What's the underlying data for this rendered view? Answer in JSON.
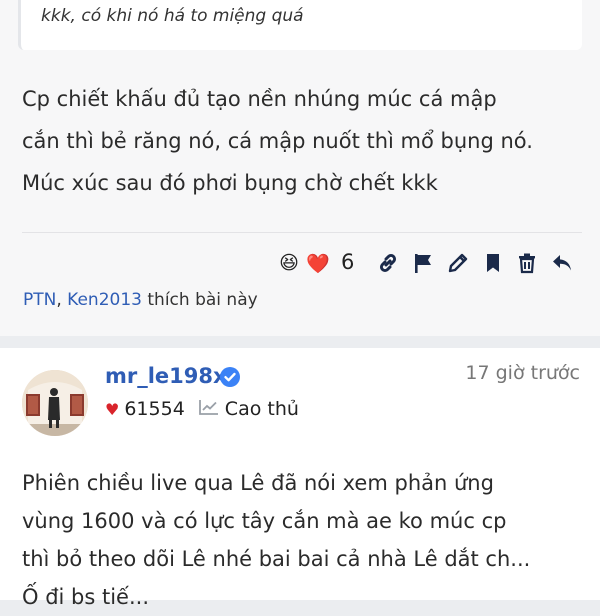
{
  "post1": {
    "quote": "kkk, có khi nó há to miệng quá",
    "body_lines": [
      "Cp chiết khấu đủ tạo nền nhúng múc cá mập",
      "cắn thì bẻ răng nó, cá mập nuốt thì mổ bụng nó.",
      "Múc xúc sau đó phơi bụng chờ chết kkk"
    ],
    "reactions": {
      "emoji": "😆",
      "heart": "❤️",
      "count": "6"
    },
    "icons": [
      "link-icon",
      "flag-icon",
      "pencil-icon",
      "bookmark-icon",
      "trash-icon",
      "reply-icon"
    ],
    "liked_by": {
      "user1": "PTN",
      "sep": ",",
      "user2": "Ken2013",
      "suffix": "thích bài này"
    }
  },
  "post2": {
    "username": "mr_le198x",
    "time": "17 giờ trước",
    "points": "61554",
    "rank": "Cao thủ",
    "body_lines": [
      "Phiên chiều live qua Lê đã nói xem phản ứng",
      "vùng 1600 và có lực tây cắn mà ae ko múc cp",
      "thì bỏ theo dõi Lê nhé bai bai cả nhà Lê dắt ch...",
      "Ố đi bs tiế..."
    ]
  },
  "colors": {
    "link": "#2f5db5",
    "heart": "#d9242b",
    "verified": "#3b82f6"
  }
}
